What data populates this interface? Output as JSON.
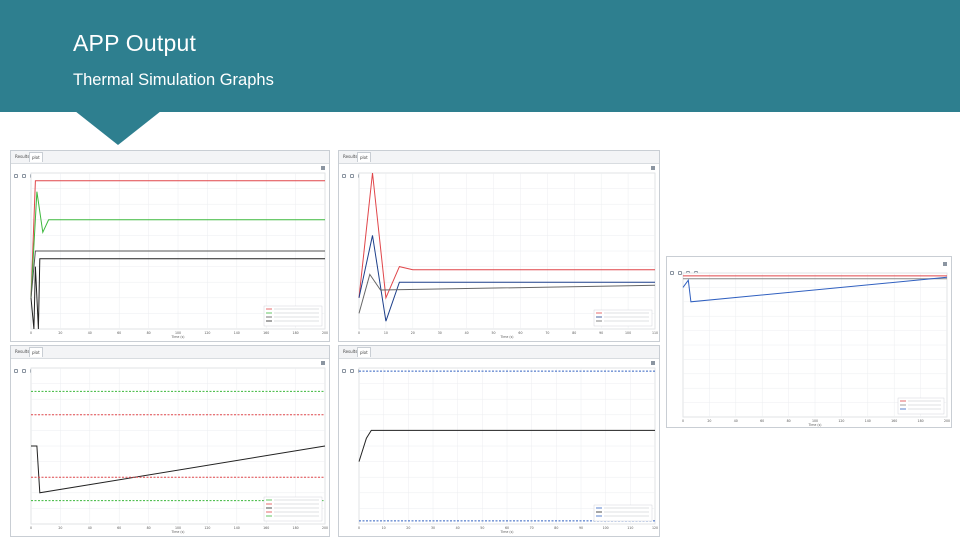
{
  "header": {
    "title": "APP Output",
    "subtitle": "Thermal Simulation Graphs",
    "color": "#2e7f8f"
  },
  "panels": [
    {
      "tabs": [
        "Results",
        "plot"
      ]
    },
    {
      "tabs": [
        "Results",
        "plot"
      ]
    },
    {
      "tabs": [
        "Results",
        "plot"
      ]
    },
    {
      "tabs": [
        "Results",
        "plot"
      ]
    }
  ],
  "chart_data": [
    {
      "type": "line",
      "x_ticks": [
        "0",
        "20",
        "40",
        "60",
        "80",
        "100",
        "120",
        "140",
        "160",
        "180",
        "200"
      ],
      "xlabel": "Time (s)",
      "series": [
        {
          "color": "#e0464a",
          "x": [
            0,
            3,
            6,
            200
          ],
          "y": [
            20,
            95,
            95,
            95
          ]
        },
        {
          "color": "#3db83d",
          "x": [
            0,
            4,
            8,
            12,
            200
          ],
          "y": [
            20,
            88,
            62,
            70,
            70
          ]
        },
        {
          "color": "#555555",
          "x": [
            0,
            3,
            6,
            200
          ],
          "y": [
            20,
            50,
            50,
            50
          ]
        },
        {
          "color": "#222222",
          "x": [
            0,
            2,
            3,
            5,
            6,
            200
          ],
          "y": [
            20,
            0,
            40,
            0,
            45,
            45
          ]
        }
      ],
      "xlim": [
        0,
        200
      ],
      "ylim": [
        0,
        100
      ]
    },
    {
      "type": "line",
      "x_ticks": [
        "0",
        "10",
        "20",
        "30",
        "40",
        "50",
        "60",
        "70",
        "80",
        "90",
        "100",
        "110"
      ],
      "xlabel": "Time (s)",
      "series": [
        {
          "color": "#e0464a",
          "x": [
            0,
            5,
            10,
            15,
            20,
            110
          ],
          "y": [
            20,
            100,
            20,
            40,
            38,
            38
          ]
        },
        {
          "color": "#1c3f8a",
          "x": [
            0,
            5,
            10,
            15,
            20,
            110
          ],
          "y": [
            20,
            60,
            5,
            30,
            30,
            30
          ]
        },
        {
          "color": "#666666",
          "x": [
            0,
            4,
            8,
            110
          ],
          "y": [
            10,
            35,
            25,
            28
          ]
        }
      ],
      "xlim": [
        0,
        110
      ],
      "ylim": [
        0,
        100
      ]
    },
    {
      "type": "line",
      "x_ticks": [
        "0",
        "20",
        "40",
        "60",
        "80",
        "100",
        "120",
        "140",
        "160",
        "180",
        "200"
      ],
      "xlabel": "Time (s)",
      "series": [
        {
          "color": "#3db83d",
          "dash": true,
          "x": [
            0,
            200
          ],
          "y": [
            85,
            85
          ]
        },
        {
          "color": "#e0464a",
          "dash": true,
          "x": [
            0,
            200
          ],
          "y": [
            70,
            70
          ]
        },
        {
          "color": "#222222",
          "x": [
            0,
            4,
            6,
            200
          ],
          "y": [
            50,
            50,
            20,
            50
          ]
        },
        {
          "color": "#e0464a",
          "dash": true,
          "x": [
            0,
            200
          ],
          "y": [
            30,
            30
          ]
        },
        {
          "color": "#3db83d",
          "dash": true,
          "x": [
            0,
            200
          ],
          "y": [
            15,
            15
          ]
        }
      ],
      "xlim": [
        0,
        200
      ],
      "ylim": [
        0,
        100
      ]
    },
    {
      "type": "line",
      "x_ticks": [
        "0",
        "10",
        "20",
        "30",
        "40",
        "50",
        "60",
        "70",
        "80",
        "90",
        "100",
        "110",
        "120"
      ],
      "xlabel": "Time (s)",
      "series": [
        {
          "color": "#3060c0",
          "dash": true,
          "x": [
            0,
            120
          ],
          "y": [
            98,
            98
          ]
        },
        {
          "color": "#222222",
          "x": [
            0,
            3,
            5,
            120
          ],
          "y": [
            40,
            55,
            60,
            60
          ]
        },
        {
          "color": "#3060c0",
          "dash": true,
          "x": [
            0,
            120
          ],
          "y": [
            2,
            2
          ]
        }
      ],
      "xlim": [
        0,
        120
      ],
      "ylim": [
        0,
        100
      ]
    },
    {
      "type": "line",
      "x_ticks": [
        "0",
        "20",
        "40",
        "60",
        "80",
        "100",
        "120",
        "140",
        "160",
        "180",
        "200"
      ],
      "xlabel": "Time (s)",
      "series": [
        {
          "color": "#e0464a",
          "x": [
            0,
            4,
            200
          ],
          "y": [
            98,
            98,
            98
          ]
        },
        {
          "color": "#888888",
          "x": [
            0,
            200
          ],
          "y": [
            96,
            96
          ]
        },
        {
          "color": "#3060c0",
          "x": [
            0,
            4,
            6,
            200
          ],
          "y": [
            90,
            95,
            80,
            97
          ]
        }
      ],
      "xlim": [
        0,
        200
      ],
      "ylim": [
        0,
        100
      ]
    }
  ]
}
